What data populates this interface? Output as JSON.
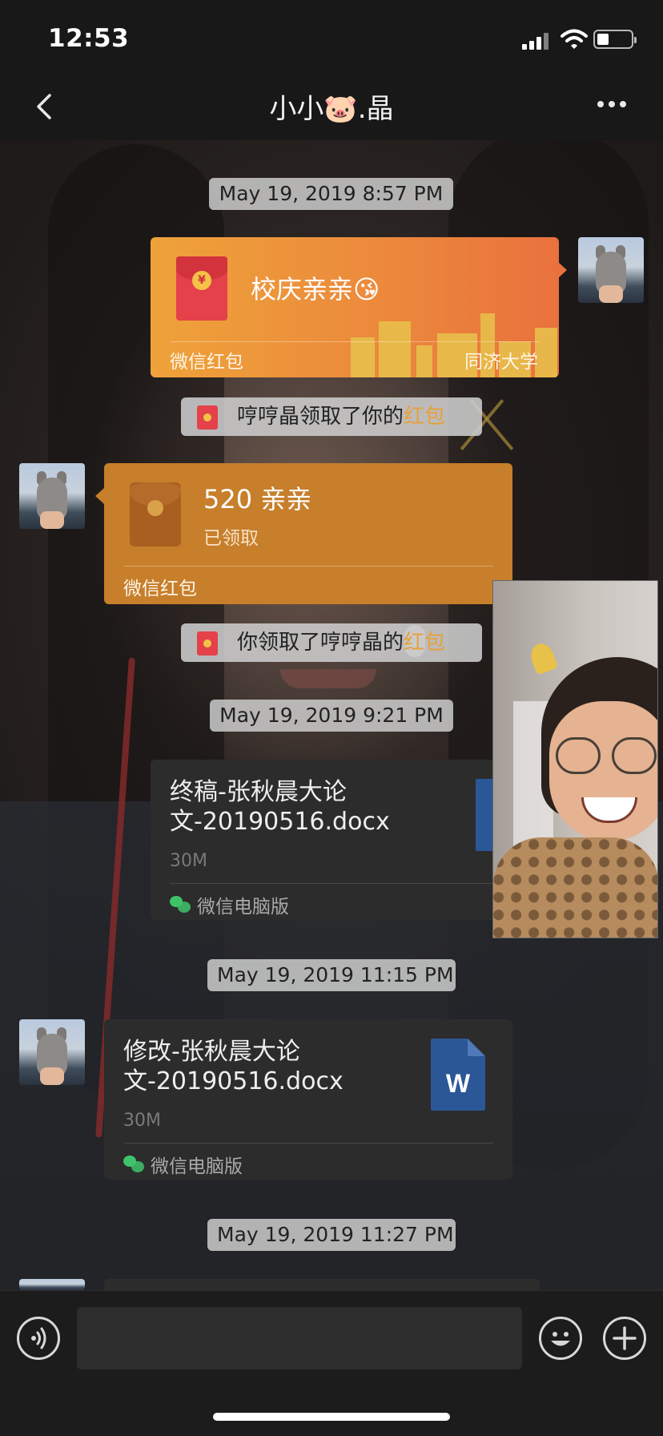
{
  "status_bar": {
    "time": "12:53",
    "battery_fraction": 0.35
  },
  "nav": {
    "title": "小小🐷.晶",
    "back_icon": "chevron-left-icon",
    "more_icon": "ellipsis-icon"
  },
  "messages": {
    "stamp1": "May 19, 2019 8:57 PM",
    "red_packet_sent": {
      "message": "校庆亲亲😘",
      "footer_left": "微信红包",
      "footer_right": "同济大学"
    },
    "notice1": {
      "prefix": "哼哼晶领取了你的",
      "highlight": "红包"
    },
    "red_packet_received": {
      "message": "520 亲亲",
      "status": "已领取",
      "footer_left": "微信红包"
    },
    "notice2": {
      "prefix": "你领取了哼哼晶的",
      "highlight": "红包"
    },
    "stamp2": "May 19, 2019 9:21 PM",
    "file1": {
      "name": "终稿-张秋晨大论文-20190516.docx",
      "size": "30M",
      "source": "微信电脑版"
    },
    "stamp3": "May 19, 2019 11:15 PM",
    "file2": {
      "name": "修改-张秋晨大论文-20190516.docx",
      "size": "30M",
      "source": "微信电脑版",
      "icon_letter": "W"
    },
    "stamp4": "May 19, 2019 11:27 PM"
  },
  "colors": {
    "red_packet_sent": "#ec8a3c",
    "red_packet_opened": "#c77f2c",
    "highlight": "#e6a13a",
    "file_card": "#2c2c2c",
    "word_blue": "#2b5797"
  },
  "input_bar": {
    "voice_icon": "voice-icon",
    "emoji_icon": "emoji-icon",
    "plus_icon": "plus-icon"
  }
}
